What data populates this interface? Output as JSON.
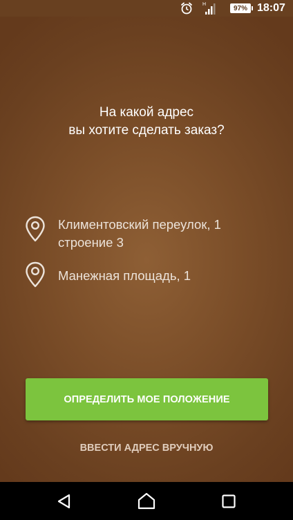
{
  "status_bar": {
    "time": "18:07",
    "battery": "97%",
    "icons": [
      "alarm-icon",
      "signal-icon",
      "battery-icon"
    ]
  },
  "question": {
    "line1": "На какой адрес",
    "line2": "вы хотите сделать заказ?"
  },
  "addresses": [
    {
      "line1": "Климентовский переулок, 1",
      "line2": "строение 3",
      "icon": "location-pin-icon"
    },
    {
      "line1": "Манежная площадь, 1",
      "line2": "",
      "icon": "location-pin-icon"
    }
  ],
  "buttons": {
    "locate_label": "ОПРЕДЕЛИТЬ МОЕ ПОЛОЖЕНИЕ",
    "manual_label": "ВВЕСТИ АДРЕС ВРУЧНУЮ"
  },
  "navigation": {
    "icons": [
      "back-icon",
      "home-icon",
      "recents-icon"
    ]
  },
  "colors": {
    "background": "#7a4d28",
    "button_green": "#7cc43e",
    "text_light": "#ece3da"
  }
}
